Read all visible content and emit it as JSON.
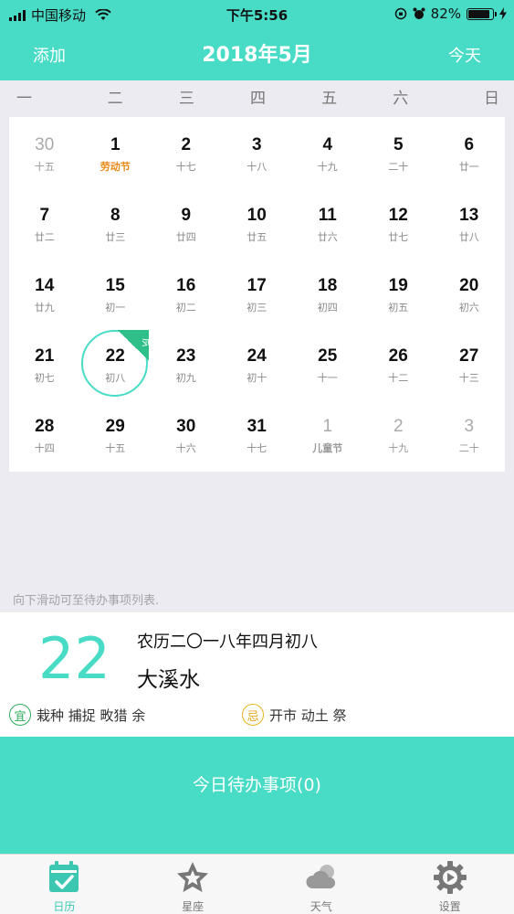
{
  "status_bar": {
    "carrier": "中国移动",
    "time": "下午5:56",
    "battery": "82%",
    "battery_level": 0.82
  },
  "nav": {
    "add_label": "添加",
    "title": "2018年5月",
    "today_label": "今天"
  },
  "weekdays": [
    "一",
    "二",
    "三",
    "四",
    "五",
    "六",
    "日"
  ],
  "calendar": {
    "today_tag": "今天",
    "weeks": [
      [
        {
          "day": "30",
          "lunar": "十五",
          "other": true
        },
        {
          "day": "1",
          "lunar": "劳动节",
          "holiday": true
        },
        {
          "day": "2",
          "lunar": "十七"
        },
        {
          "day": "3",
          "lunar": "十八"
        },
        {
          "day": "4",
          "lunar": "十九"
        },
        {
          "day": "5",
          "lunar": "二十"
        },
        {
          "day": "6",
          "lunar": "廿一"
        }
      ],
      [
        {
          "day": "7",
          "lunar": "廿二"
        },
        {
          "day": "8",
          "lunar": "廿三"
        },
        {
          "day": "9",
          "lunar": "廿四"
        },
        {
          "day": "10",
          "lunar": "廿五"
        },
        {
          "day": "11",
          "lunar": "廿六"
        },
        {
          "day": "12",
          "lunar": "廿七"
        },
        {
          "day": "13",
          "lunar": "廿八"
        }
      ],
      [
        {
          "day": "14",
          "lunar": "廿九"
        },
        {
          "day": "15",
          "lunar": "初一"
        },
        {
          "day": "16",
          "lunar": "初二"
        },
        {
          "day": "17",
          "lunar": "初三"
        },
        {
          "day": "18",
          "lunar": "初四"
        },
        {
          "day": "19",
          "lunar": "初五"
        },
        {
          "day": "20",
          "lunar": "初六"
        }
      ],
      [
        {
          "day": "21",
          "lunar": "初七"
        },
        {
          "day": "22",
          "lunar": "初八",
          "today": true
        },
        {
          "day": "23",
          "lunar": "初九"
        },
        {
          "day": "24",
          "lunar": "初十"
        },
        {
          "day": "25",
          "lunar": "十一"
        },
        {
          "day": "26",
          "lunar": "十二"
        },
        {
          "day": "27",
          "lunar": "十三"
        }
      ],
      [
        {
          "day": "28",
          "lunar": "十四"
        },
        {
          "day": "29",
          "lunar": "十五"
        },
        {
          "day": "30",
          "lunar": "十六"
        },
        {
          "day": "31",
          "lunar": "十七"
        },
        {
          "day": "1",
          "lunar": "儿童节",
          "other": true,
          "holiday": true
        },
        {
          "day": "2",
          "lunar": "十九",
          "other": true
        },
        {
          "day": "3",
          "lunar": "二十",
          "other": true
        }
      ]
    ]
  },
  "hint": "向下滑动可至待办事项列表.",
  "detail": {
    "day": "22",
    "lunar_date": "农历二〇一八年四月初八",
    "wuxing": "大溪水",
    "yi_badge": "宜",
    "yi_text": "栽种 捕捉 畋猎 余",
    "ji_badge": "忌",
    "ji_text": "开市 动土 祭"
  },
  "todo": {
    "label": "今日待办事项(0)"
  },
  "tabs": [
    {
      "label": "日历",
      "icon": "calendar-check-icon",
      "active": true
    },
    {
      "label": "星座",
      "icon": "star-icon"
    },
    {
      "label": "天气",
      "icon": "cloud-sun-icon"
    },
    {
      "label": "设置",
      "icon": "gear-icon"
    }
  ],
  "colors": {
    "accent": "#48dcc6",
    "holiday": "#e8891a",
    "yi": "#2eaa5a",
    "ji": "#e6a41a"
  }
}
